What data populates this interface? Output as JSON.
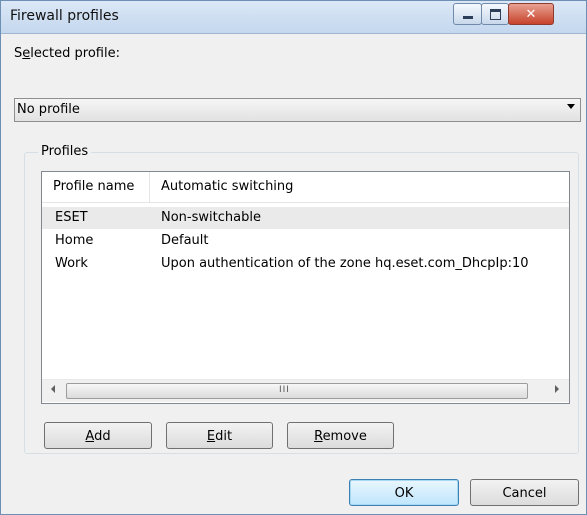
{
  "window": {
    "title": "Firewall profiles"
  },
  "selected_profile": {
    "label_prefix": "S",
    "label_underlined": "e",
    "label_rest": "lected profile:",
    "value": "No profile"
  },
  "profiles_group": {
    "label": "Profiles",
    "columns": [
      "Profile name",
      "Automatic switching"
    ],
    "rows": [
      {
        "name": "ESET",
        "switching": "Non-switchable"
      },
      {
        "name": "Home",
        "switching": "Default"
      },
      {
        "name": "Work",
        "switching": "Upon authentication of the zone hq.eset.com_DhcpIp:10"
      }
    ],
    "scroll_grip": "III"
  },
  "buttons": {
    "add_u": "A",
    "add_rest": "dd",
    "edit_u": "E",
    "edit_rest": "dit",
    "remove_u": "R",
    "remove_rest": "emove",
    "ok": "OK",
    "cancel": "Cancel"
  },
  "icons": {
    "minimize": "minimize-icon",
    "maximize": "maximize-icon",
    "close": "close-icon",
    "dropdown": "chevron-down-icon",
    "scroll_left": "arrow-left-icon",
    "scroll_right": "arrow-right-icon"
  }
}
